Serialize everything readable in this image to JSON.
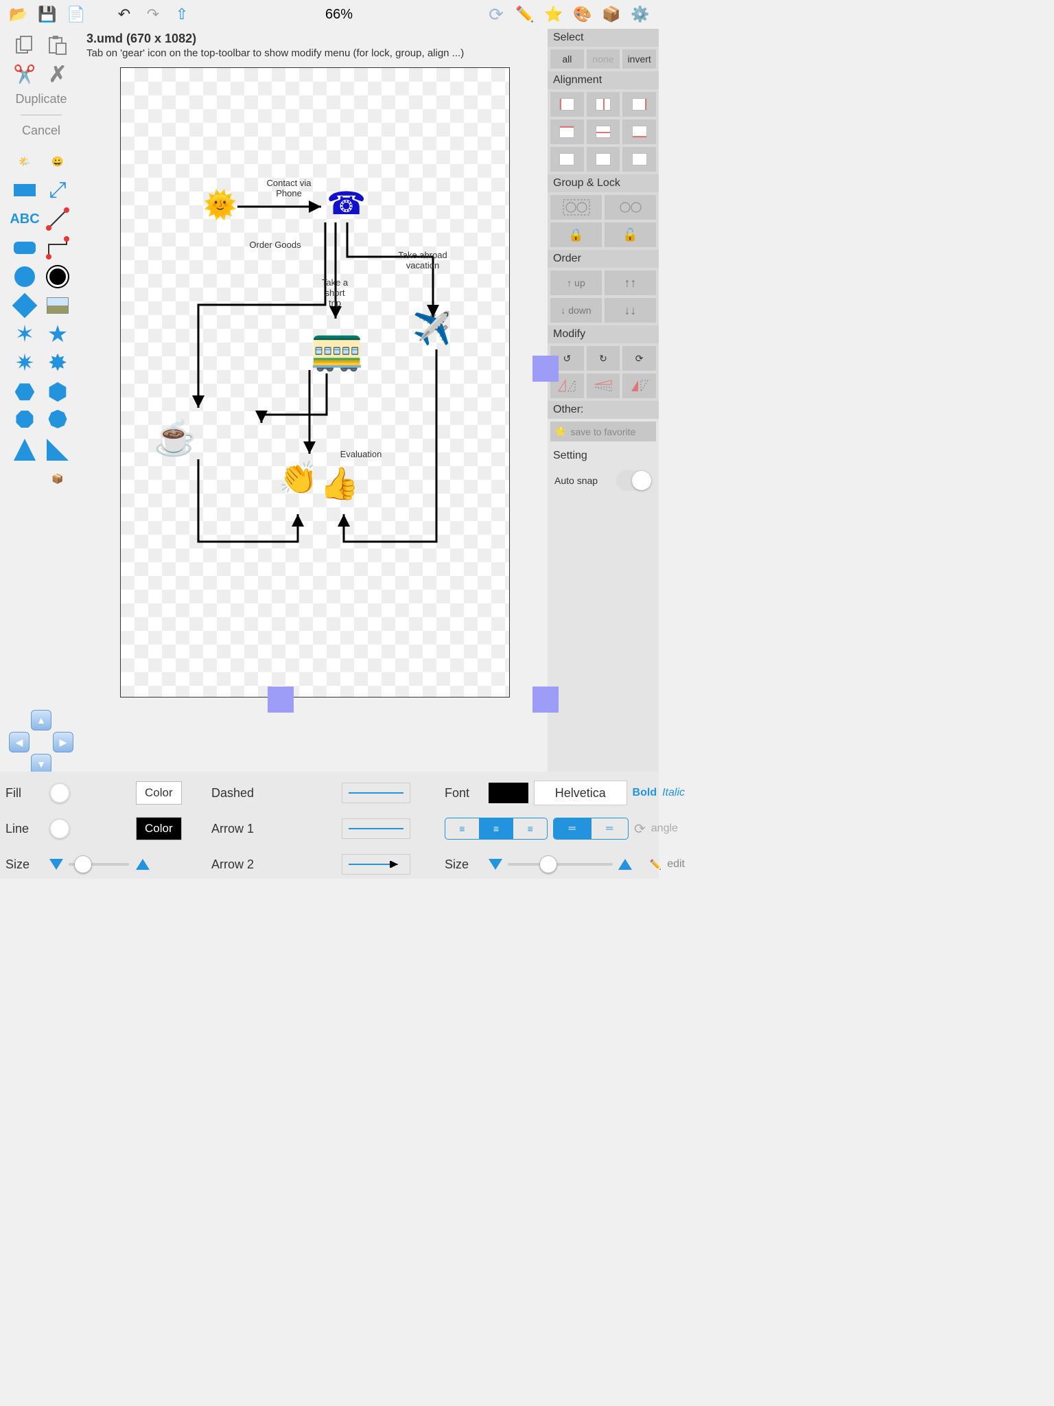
{
  "toolbar": {
    "zoom": "66%"
  },
  "document": {
    "title": "3.umd (670 x 1082)",
    "hint": "Tab on 'gear' icon on the top-toolbar to show modify menu (for lock, group, align ...)"
  },
  "diagram": {
    "labels": {
      "contact": "Contact via\nPhone",
      "order": "Order Goods",
      "short_trip": "Take a\nshort\ntrip",
      "abroad": "Take abroad\nvacation",
      "evaluation": "Evaluation"
    }
  },
  "left": {
    "duplicate": "Duplicate",
    "cancel": "Cancel",
    "abc": "ABC"
  },
  "right": {
    "select_title": "Select",
    "select": {
      "all": "all",
      "none": "none",
      "invert": "invert"
    },
    "alignment_title": "Alignment",
    "group_title": "Group & Lock",
    "order_title": "Order",
    "order": {
      "up": "↑  up",
      "down": "↓  down",
      "top": "↑↑",
      "bottom": "↓↓"
    },
    "modify_title": "Modify",
    "other_title": "Other:",
    "fav": "save to favorite",
    "setting_title": "Setting",
    "auto_snap": "Auto snap"
  },
  "bottom": {
    "fill": "Fill",
    "line": "Line",
    "size": "Size",
    "color": "Color",
    "dashed": "Dashed",
    "arrow1": "Arrow 1",
    "arrow2": "Arrow 2",
    "font": "Font",
    "font_name": "Helvetica",
    "bold": "Bold",
    "italic": "Italic",
    "angle": "angle",
    "edit": "edit",
    "size2": "Size"
  }
}
